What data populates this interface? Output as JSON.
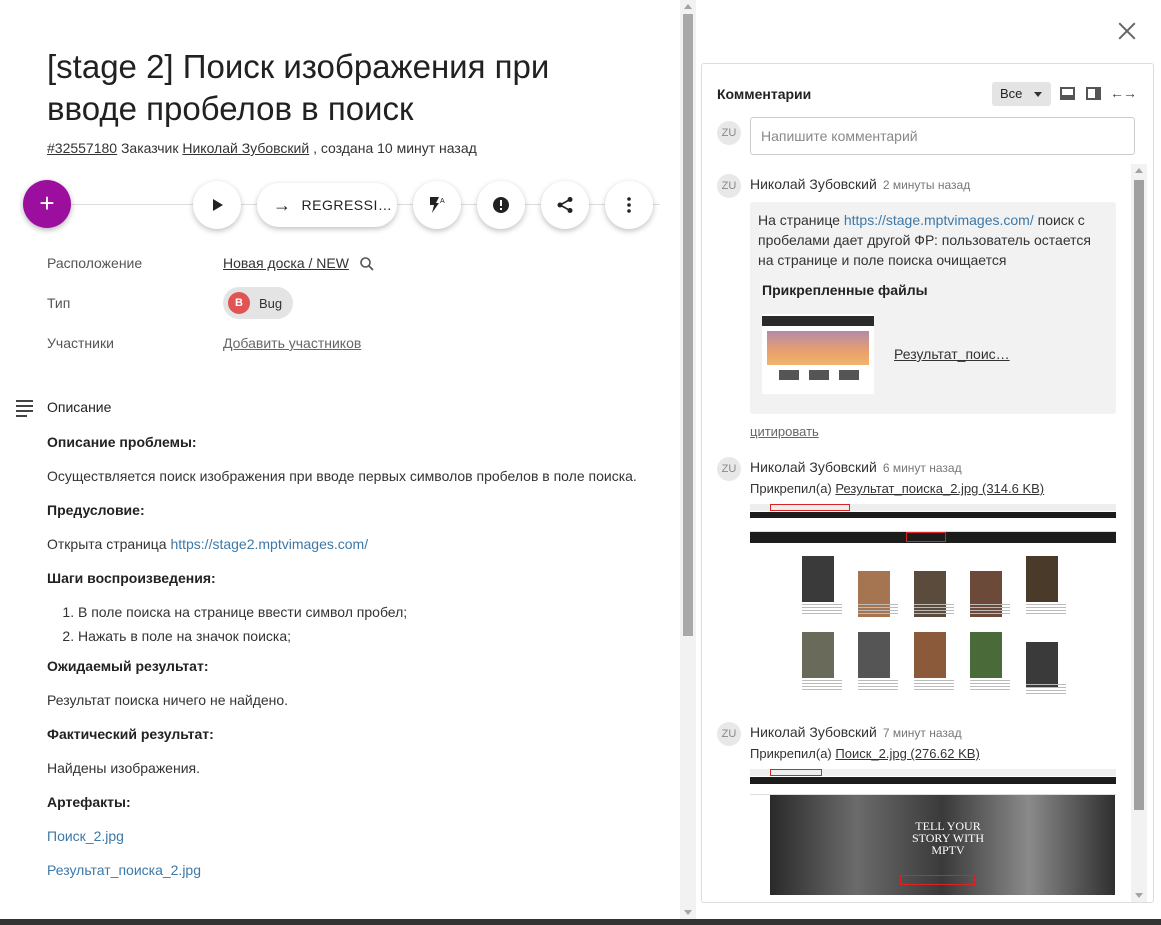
{
  "task": {
    "title": "[stage 2] Поиск изображения при вводе пробелов в поиск",
    "id": "#32557180",
    "customer_label": "Заказчик",
    "customer_name": "Николай Зубовский",
    "created": ", создана 10 минут назад"
  },
  "actions": {
    "add": "+",
    "state_label": "REGRESSI…",
    "play_icon": "play-icon",
    "flash_icon": "flash-auto-icon",
    "alert_icon": "alert-icon",
    "share_icon": "share-icon",
    "more_icon": "more-vert-icon"
  },
  "fields": {
    "location_label": "Расположение",
    "location_value": "Новая доска / NEW",
    "type_label": "Тип",
    "type_badge": "B",
    "type_value": "Bug",
    "members_label": "Участники",
    "members_value": "Добавить участников"
  },
  "description": {
    "heading": "Описание",
    "problem_h": "Описание проблемы:",
    "problem_text": "Осуществляется поиск изображения при вводе первых символов пробелов в поле поиска.",
    "precondition_h": "Предусловие:",
    "precondition_text": "Открыта страница ",
    "precondition_link": "https://stage2.mptvimages.com/",
    "steps_h": "Шаги воспроизведения:",
    "steps": [
      "В поле поиска на странице ввести символ пробел;",
      "Нажать в поле на значок поиска;"
    ],
    "expected_h": "Ожидаемый результат:",
    "expected_text": "Результат поиска ничего не найдено.",
    "actual_h": "Фактический результат:",
    "actual_text": "Найдены изображения.",
    "artifacts_h": "Артефакты:",
    "artifacts": [
      "Поиск_2.jpg",
      "Результат_поиска_2.jpg"
    ]
  },
  "comments": {
    "title": "Комментарии",
    "filter": "Все",
    "input_placeholder": "Напишите комментарий",
    "avatar": "ZU",
    "items": [
      {
        "author": "Николай Зубовский",
        "time": "2 минуты назад",
        "text_before": "На странице ",
        "link": "https://stage.mptvimages.com/",
        "text_after": " поиск с пробелами дает другой ФР: пользователь остается на странице и поле поиска очищается",
        "attachments_h": "Прикрепленные файлы",
        "attachment_name": "Результат_поис…",
        "quote": "цитировать"
      },
      {
        "author": "Николай Зубовский",
        "time": "6 минут назад",
        "attached_prefix": "Прикрепил(а) ",
        "file": "Результат_поиска_2.jpg (314.6 KB)"
      },
      {
        "author": "Николай Зубовский",
        "time": "7 минут назад",
        "attached_prefix": "Прикрепил(а) ",
        "file": "Поиск_2.jpg (276.62 KB)",
        "image_text": "TELL YOUR STORY WITH MPTV"
      }
    ]
  },
  "colors": {
    "fab": "#9c0e9e",
    "link": "#3c78a8",
    "bug": "#e05454"
  }
}
